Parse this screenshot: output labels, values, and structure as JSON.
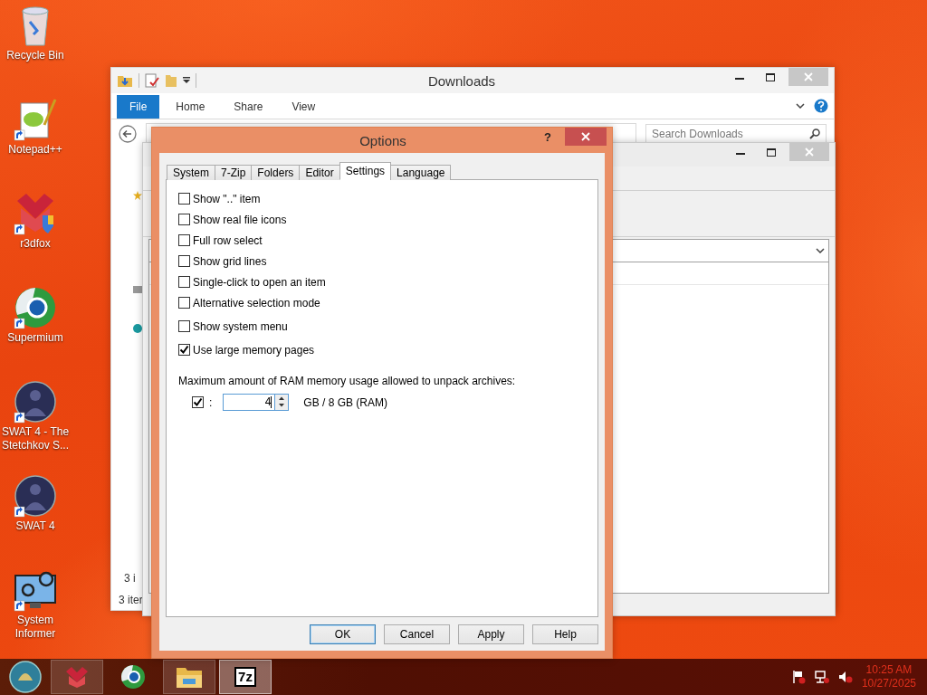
{
  "desktop_icons": [
    {
      "kind": "recycle-bin",
      "label": "Recycle Bin",
      "shortcut": false
    },
    {
      "kind": "notepad",
      "label": "Notepad++",
      "shortcut": true
    },
    {
      "kind": "red-cube",
      "label": "r3dfox",
      "shortcut": true
    },
    {
      "kind": "browser",
      "label": "Supermium",
      "shortcut": true
    },
    {
      "kind": "game",
      "label": "SWAT 4 - The Stetchkov S...",
      "shortcut": true
    },
    {
      "kind": "game",
      "label": "SWAT 4",
      "shortcut": true
    },
    {
      "kind": "monitor",
      "label": "System Informer",
      "shortcut": true
    }
  ],
  "explorer": {
    "title": "Downloads",
    "ribbon_tabs": [
      {
        "label": "File",
        "selected": true
      },
      {
        "label": "Home",
        "selected": false
      },
      {
        "label": "Share",
        "selected": false
      },
      {
        "label": "View",
        "selected": false
      }
    ],
    "search": {
      "placeholder": "Search Downloads"
    },
    "details_text": "3 i",
    "status": "3 iter"
  },
  "options": {
    "title": "Options",
    "help": "?",
    "tabs": [
      {
        "label": "System",
        "selected": false
      },
      {
        "label": "7-Zip",
        "selected": false
      },
      {
        "label": "Folders",
        "selected": false
      },
      {
        "label": "Editor",
        "selected": false
      },
      {
        "label": "Settings",
        "selected": true
      },
      {
        "label": "Language",
        "selected": false
      }
    ],
    "checkbox_groups": [
      [
        {
          "label": "Show \"..\" item",
          "checked": false
        },
        {
          "label": "Show real file icons",
          "checked": false
        },
        {
          "label": "Full row select",
          "checked": false
        },
        {
          "label": "Show grid lines",
          "checked": false
        },
        {
          "label": "Single-click to open an item",
          "checked": false
        },
        {
          "label": "Alternative selection mode",
          "checked": false
        }
      ],
      [
        {
          "label": "Show system menu",
          "checked": false
        }
      ],
      [
        {
          "label": "Use large memory pages",
          "checked": true
        }
      ]
    ],
    "memory_label": "Maximum amount of RAM memory usage allowed to unpack archives:",
    "memory_limit": {
      "checked": true,
      "separator": ":",
      "value": "4",
      "unit": "GB / 8 GB (RAM)"
    },
    "buttons": [
      {
        "label": "OK",
        "default": true
      },
      {
        "label": "Cancel",
        "default": false
      },
      {
        "label": "Apply",
        "default": false
      },
      {
        "label": "Help",
        "default": false
      }
    ]
  },
  "taskbar": {
    "apps": [
      {
        "kind": "red-cube",
        "running": true,
        "selected": false
      },
      {
        "kind": "browser",
        "running": false,
        "selected": false
      },
      {
        "kind": "folder",
        "running": true,
        "selected": false
      },
      {
        "kind": "archiver",
        "label": "7z",
        "running": true,
        "selected": true
      }
    ],
    "clock": {
      "time": "10:25 AM",
      "date": "10/27/2025"
    }
  }
}
